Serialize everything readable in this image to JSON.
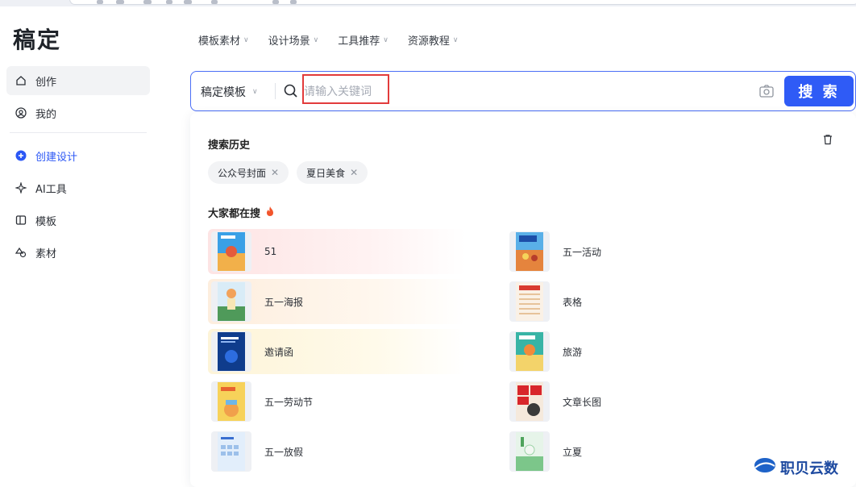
{
  "brand": {
    "logo": "稿定"
  },
  "topnav": [
    {
      "label": "模板素材"
    },
    {
      "label": "设计场景"
    },
    {
      "label": "工具推荐"
    },
    {
      "label": "资源教程"
    }
  ],
  "sidebar": {
    "items": [
      {
        "label": "创作",
        "icon": "home-icon"
      },
      {
        "label": "我的",
        "icon": "user-icon"
      },
      {
        "label": "创建设计",
        "icon": "plus-circle-icon"
      },
      {
        "label": "AI工具",
        "icon": "sparkle-icon"
      },
      {
        "label": "模板",
        "icon": "template-icon"
      },
      {
        "label": "素材",
        "icon": "shapes-icon"
      }
    ]
  },
  "search": {
    "type_label": "稿定模板",
    "placeholder": "请输入关键词",
    "button_label": "搜 索"
  },
  "panel": {
    "history_title": "搜索历史",
    "history_tags": [
      "公众号封面",
      "夏日美食"
    ],
    "hot_title": "大家都在搜",
    "hot_items": [
      {
        "label": "51"
      },
      {
        "label": "五一活动"
      },
      {
        "label": "五一海报"
      },
      {
        "label": "表格"
      },
      {
        "label": "邀请函"
      },
      {
        "label": "旅游"
      },
      {
        "label": "五一劳动节"
      },
      {
        "label": "文章长图"
      },
      {
        "label": "五一放假"
      },
      {
        "label": "立夏"
      }
    ]
  },
  "watermark": {
    "text": "职贝云数"
  },
  "colors": {
    "accent": "#2f5bf6",
    "highlight_box": "#e23b3b"
  }
}
